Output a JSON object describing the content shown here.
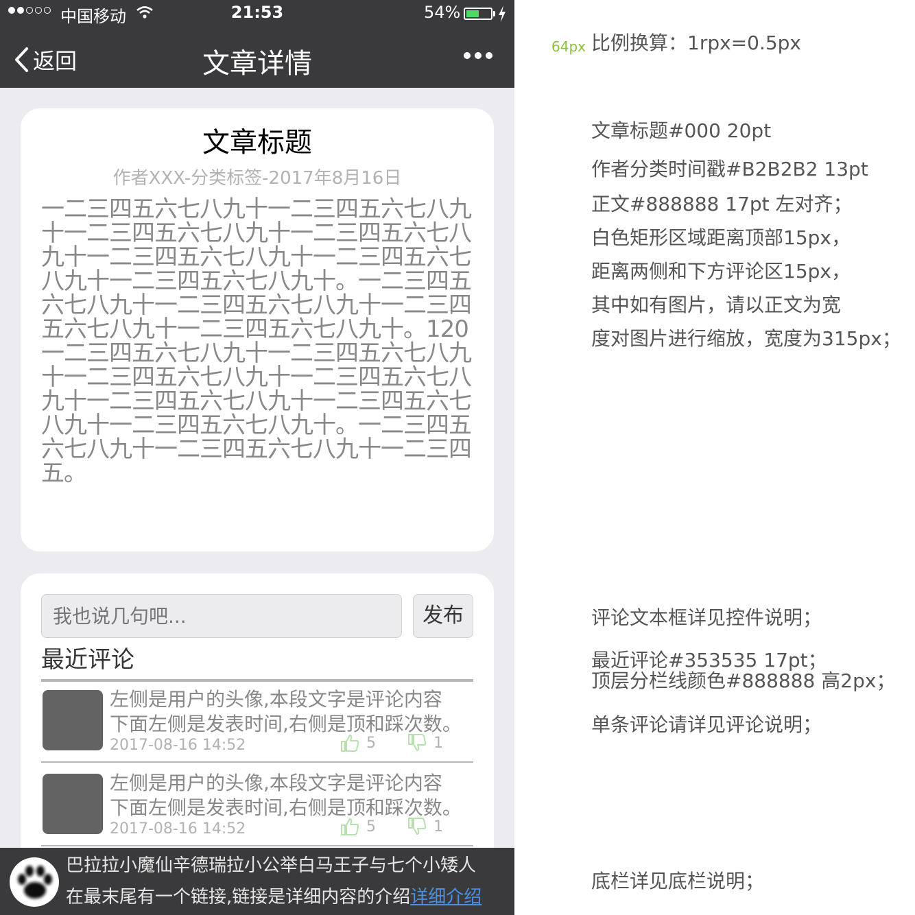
{
  "status_bar": {
    "carrier": "中国移动",
    "time": "21:53",
    "battery_percent": "54%",
    "battery_level": 0.54
  },
  "nav": {
    "back_label": "返回",
    "title": "文章详情"
  },
  "article": {
    "title": "文章标题",
    "meta": "作者XXX-分类标签-2017年8月16日",
    "body": "一二三四五六七八九十一二三四五六七八九十一二三四五六七八九十一二三四五六七八九十一二三四五六七八九十一二三四五六七八九十一二三四五六七八九十。一二三四五六七八九十一二三四五六七八九十一二三四五六七八九十一二三四五六七八九十。120一二三四五六七八九十一二三四五六七八九十一二三四五六七八九十一二三四五六七八九十一二三四五六七八九十一二三四五六七八九十一二三四五六七八九十。一二三四五六七八九十一二三四五六七八九十一二三四五。"
  },
  "comments": {
    "input_placeholder": "我也说几句吧...",
    "publish_label": "发布",
    "section_title": "最近评论",
    "items": [
      {
        "text_line1": "左侧是用户的头像,本段文字是评论内容",
        "text_line2": "下面左侧是发表时间,右侧是顶和踩次数。",
        "time": "2017-08-16  14:52",
        "up_count": "5",
        "down_count": "1"
      },
      {
        "text_line1": "左侧是用户的头像,本段文字是评论内容",
        "text_line2": "下面左侧是发表时间,右侧是顶和踩次数。",
        "time": "2017-08-16  14:52",
        "up_count": "5",
        "down_count": "1"
      }
    ]
  },
  "footer": {
    "line1": "巴拉拉小魔仙辛德瑞拉小公举白马王子与七个小矮人",
    "line2_text": "在最末尾有一个链接,链接是详细内容的介绍",
    "link_text": "详细介绍"
  },
  "annotations": {
    "ratio_tag": "64px",
    "ratio": "比例换算：1rpx=0.5px",
    "title_spec": "文章标题#000 20pt",
    "meta_spec": "作者分类时间戳#B2B2B2 13pt",
    "body_spec": "正文#888888 17pt 左对齐；",
    "margin_top": "白色矩形区域距离顶部15px，",
    "margin_side": "距离两侧和下方评论区15px，",
    "image_note1": "其中如有图片，请以正文为宽",
    "image_note2": "度对图片进行缩放，宽度为315px；",
    "comment_box": "评论文本框详见控件说明；",
    "recent_spec": "最近评论#353535 17pt；",
    "divider_spec": "顶层分栏线颜色#888888 高2px；",
    "single_comment": "单条评论请详见评论说明；",
    "footer_note": "底栏详见底栏说明；"
  },
  "colors": {
    "bar_bg": "#3a3a3c",
    "title": "#000000",
    "meta": "#b2b2b2",
    "body": "#888888",
    "recent": "#353535",
    "thumb": "#b7dfb0",
    "link": "#4a90e2",
    "annotation": "#555555",
    "ratio_tag": "#8bbf3a"
  },
  "icons": [
    "wifi-icon",
    "battery-icon",
    "charging-bolt-icon",
    "back-chevron-icon",
    "more-dots-icon",
    "thumbs-up-icon",
    "thumbs-down-icon",
    "paw-avatar-icon"
  ]
}
